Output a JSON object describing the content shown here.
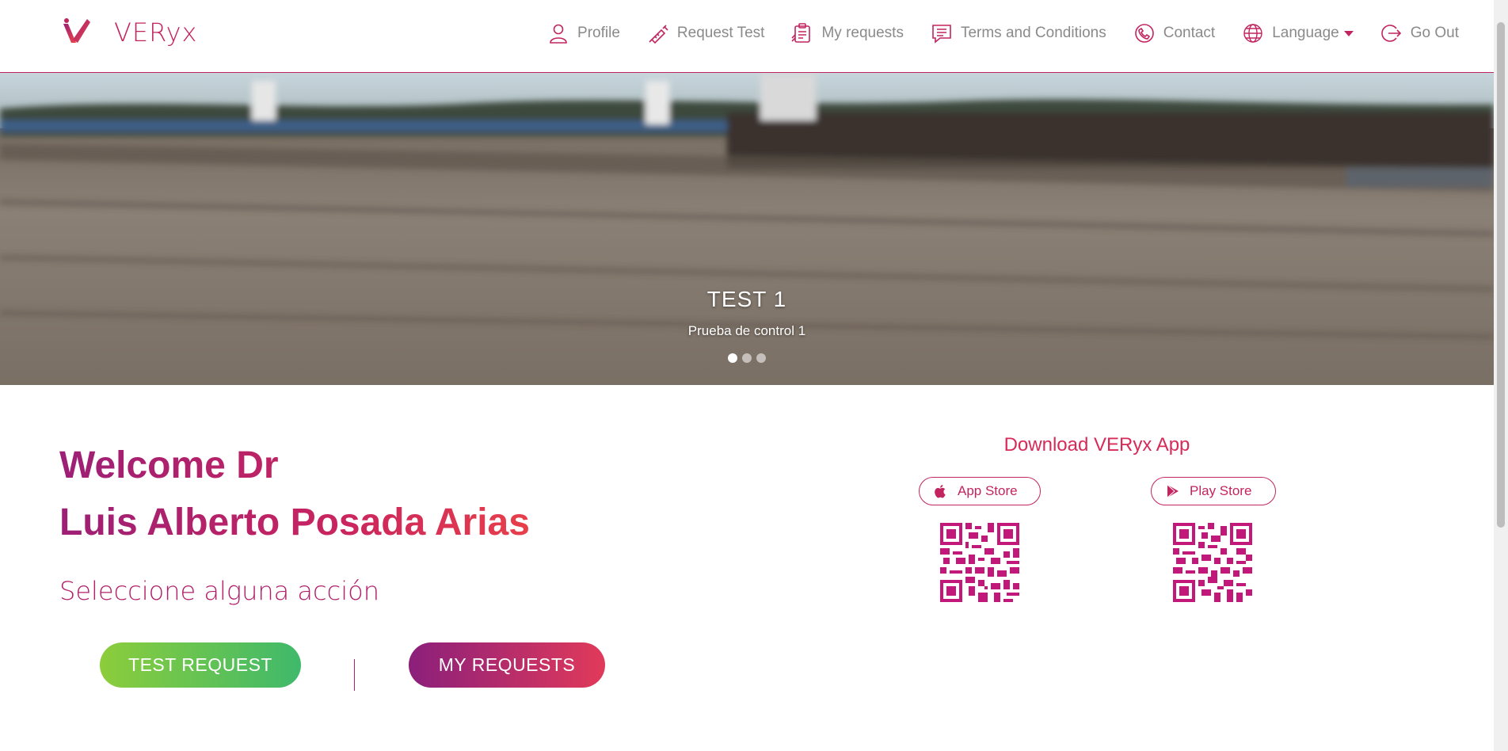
{
  "brand": {
    "name": "VERyx"
  },
  "nav": [
    {
      "label": "Profile",
      "icon": "user-icon"
    },
    {
      "label": "Request Test",
      "icon": "syringe-icon"
    },
    {
      "label": "My requests",
      "icon": "clipboard-icon"
    },
    {
      "label": "Terms and Conditions",
      "icon": "message-icon"
    },
    {
      "label": "Contact",
      "icon": "phone-icon"
    },
    {
      "label": "Language",
      "icon": "globe-icon"
    },
    {
      "label": "Go Out",
      "icon": "logout-icon"
    }
  ],
  "hero": {
    "title": "TEST 1",
    "subtitle": "Prueba de control 1",
    "slides": 3,
    "active_slide": 1
  },
  "welcome": {
    "line1": "Welcome Dr",
    "line2": "Luis Alberto Posada Arias",
    "prompt": "Seleccione alguna acción"
  },
  "actions": {
    "test_request": "TEST REQUEST",
    "my_requests": "MY REQUESTS"
  },
  "download": {
    "title": "Download VERyx App",
    "app_store": "App Store",
    "play_store": "Play Store"
  },
  "colors": {
    "accent": "#c2245f",
    "green_start": "#8ccd3b",
    "green_end": "#3fb96b",
    "purple_start": "#8b1f7b",
    "purple_end": "#e13a5a"
  }
}
